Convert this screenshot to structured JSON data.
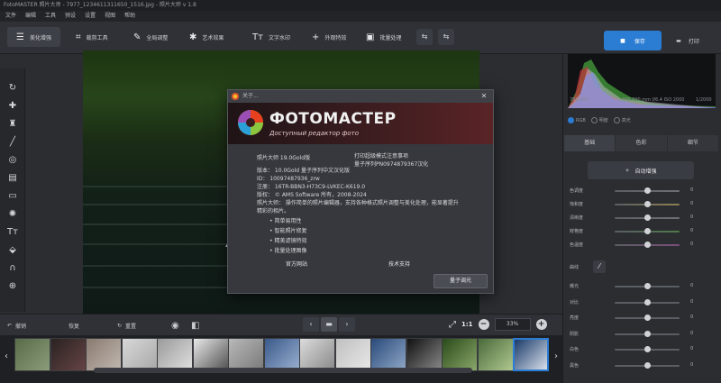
{
  "window": {
    "title": "FotoMASTER 照片大师 - 7977_1234611311650_1516.jpg    -    照片大师 v 1.8"
  },
  "menu": [
    "文件",
    "编辑",
    "工具",
    "预设",
    "设置",
    "视图",
    "帮助"
  ],
  "toolbar": {
    "tabs": [
      {
        "label": "美化增强",
        "icon": "☰"
      },
      {
        "label": "裁剪工具",
        "icon": "⌗"
      },
      {
        "label": "全局调整",
        "icon": "✎"
      },
      {
        "label": "艺术效果",
        "icon": "✱"
      },
      {
        "label": "文字水印",
        "icon": "Tт"
      },
      {
        "label": "外观特效",
        "icon": "+"
      },
      {
        "label": "批量处理",
        "icon": "▣"
      }
    ],
    "icon_btn_1": "⇆",
    "icon_btn_2": "⇆",
    "save_label": "保存",
    "print_label": "打印",
    "save_icon": "■",
    "print_icon": "▬"
  },
  "left_tools": [
    {
      "name": "rotate-icon",
      "glyph": "↻"
    },
    {
      "name": "bandaid-icon",
      "glyph": "✚"
    },
    {
      "name": "stamp-icon",
      "glyph": "♜"
    },
    {
      "name": "brush-icon",
      "glyph": "╱"
    },
    {
      "name": "radial-icon",
      "glyph": "◎"
    },
    {
      "name": "gradient-icon",
      "glyph": "▤"
    },
    {
      "name": "vignette-icon",
      "glyph": "▭"
    },
    {
      "name": "light-icon",
      "glyph": "✺"
    },
    {
      "name": "text-icon",
      "glyph": "Tт"
    },
    {
      "name": "fill-icon",
      "glyph": "⬙"
    },
    {
      "name": "magnet-icon",
      "glyph": "∩"
    },
    {
      "name": "liquify-icon",
      "glyph": "⊕"
    }
  ],
  "dialog": {
    "title": "关于...",
    "close": "✕",
    "logo_name": "ФОТОМАСТЕР",
    "logo_sub": "Доступный редактор фото",
    "product_line": "照片大师  19.0Gold版",
    "note_line1": "打印超级模式注意事项",
    "note_line2": "量子序列PN0974879367汉化",
    "info_lines": [
      "版本：  10.0Gold  量子序列中文汉化版",
      "ID：   10097487936_zrw",
      "注册：  16TR-BBN3-H73C9-LVKEC-K619.0",
      "版权：  © AMS Software 所有，2008-2024",
      "照片大师：  操作简单的照片编辑器，支持各种格式照片调整与美化处理，能显著提升",
      "              精彩的相片。"
    ],
    "bullets": [
      "• 简单易用性",
      "• 智能照片修复",
      "• 精美滤镜特效",
      "• 批量处理图像"
    ],
    "link_left": "官方网站",
    "link_right": "技术支持",
    "ok_label": "量子调光"
  },
  "histogram": {
    "left_label": "786.000",
    "mid_label": "888.000 mm f/6.4  ISO 2000",
    "right_label": "1/2000"
  },
  "channels": {
    "options": [
      "RGB",
      "明度",
      "高光"
    ],
    "selected": 0
  },
  "right_tabs": [
    "基础",
    "色彩",
    "细节"
  ],
  "autofix_label": "自动增强",
  "autofix_icon": "✧",
  "sliders_top": [
    {
      "label": "色调度",
      "value": "0",
      "level": 0.5,
      "track": "#6c6f76"
    },
    {
      "label": "饱和度",
      "value": "0",
      "level": 0.5,
      "track": "#8c8050"
    },
    {
      "label": "清晰度",
      "value": "0",
      "level": 0.5,
      "track": "#6c6f76"
    },
    {
      "label": "鲜艳度",
      "value": "0",
      "level": 0.5,
      "track": "#4f7a4a"
    },
    {
      "label": "色温度",
      "value": "0",
      "level": 0.5,
      "track": "#7a4f78"
    }
  ],
  "curves": {
    "label": "曲线",
    "icon": "⁄"
  },
  "sliders_bottom": [
    {
      "label": "曝光",
      "value": "0",
      "level": 0.5
    },
    {
      "label": "对比",
      "value": "0",
      "level": 0.5
    },
    {
      "label": "亮度",
      "value": "0",
      "level": 0.5
    },
    {
      "label": "阴影",
      "value": "0",
      "level": 0.5
    },
    {
      "label": "白色",
      "value": "0",
      "level": 0.5
    },
    {
      "label": "黑色",
      "value": "0",
      "level": 0.5
    }
  ],
  "bottombar": {
    "undo_label": "撤销",
    "undo_icon": "↶",
    "redo_label": "恢复",
    "reset_label": "重置",
    "reset_icon": "↻",
    "eye_icon": "◉",
    "compare_icon": "◧",
    "prev": "‹",
    "folder": "▬",
    "next": "›",
    "fit_icon": "⤢",
    "one_to_one": "1:1",
    "zoom_out": "−",
    "zoom_value": "33%",
    "zoom_in": "+"
  },
  "filmstrip": {
    "left": "‹",
    "right": "›",
    "thumbs": [
      {
        "c1": "#5a6b4a",
        "c2": "#8a9c7a"
      },
      {
        "c1": "#2a2222",
        "c2": "#664444"
      },
      {
        "c1": "#8a7a70",
        "c2": "#c0b8b0"
      },
      {
        "c1": "#d8d8d8",
        "c2": "#a8a8a8"
      },
      {
        "c1": "#9a9a9a",
        "c2": "#e0e0e0"
      },
      {
        "c1": "#e8e8e8",
        "c2": "#505050"
      },
      {
        "c1": "#b8b8b8",
        "c2": "#7a7a7a"
      },
      {
        "c1": "#3a5a8a",
        "c2": "#9ab0d0"
      },
      {
        "c1": "#dcdcdc",
        "c2": "#888888"
      },
      {
        "c1": "#c0c0c0",
        "c2": "#e8e8e8"
      },
      {
        "c1": "#2a4a7a",
        "c2": "#90a8c8"
      },
      {
        "c1": "#111111",
        "c2": "#8a8a8a"
      },
      {
        "c1": "#2a4a1a",
        "c2": "#8aa86a"
      },
      {
        "c1": "#4a6a3a",
        "c2": "#b0c890"
      },
      {
        "c1": "#1a3a6a",
        "c2": "#d8e0ea"
      }
    ],
    "selected": 14
  },
  "colors": {
    "accent": "#2b7cd3"
  }
}
